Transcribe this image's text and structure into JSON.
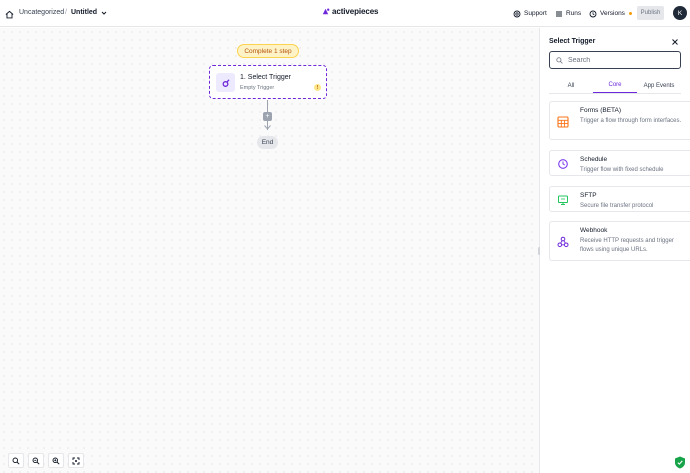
{
  "header": {
    "folder": "Uncategorized",
    "separator": "/",
    "flow_name": "Untitled",
    "logo_text": "activepieces",
    "support_label": "Support",
    "runs_label": "Runs",
    "versions_label": "Versions",
    "publish_label": "Publish",
    "avatar_initial": "K"
  },
  "canvas": {
    "status_pill": "Complete 1 step",
    "trigger": {
      "title": "1. Select Trigger",
      "subtitle": "Empty Trigger",
      "warning": "!"
    },
    "add_symbol": "+",
    "end_label": "End"
  },
  "panel": {
    "title": "Select Trigger",
    "search_placeholder": "Search",
    "tabs": [
      {
        "label": "All",
        "active": false
      },
      {
        "label": "Core",
        "active": true
      },
      {
        "label": "App Events",
        "active": false
      }
    ],
    "items": [
      {
        "title": "Forms (BETA)",
        "description": "Trigger a flow through form interfaces.",
        "icon": "forms-icon"
      },
      {
        "title": "Schedule",
        "description": "Trigger flow with fixed schedule",
        "icon": "schedule-icon"
      },
      {
        "title": "SFTP",
        "description": "Secure file transfer protocol",
        "icon": "sftp-icon"
      },
      {
        "title": "Webhook",
        "description": "Receive HTTP requests and trigger flows using unique URLs.",
        "icon": "webhook-icon"
      }
    ]
  },
  "colors": {
    "accent": "#6d28d9",
    "warning": "#f59e0b",
    "forms": "#f97316",
    "sftp": "#22c55e"
  }
}
